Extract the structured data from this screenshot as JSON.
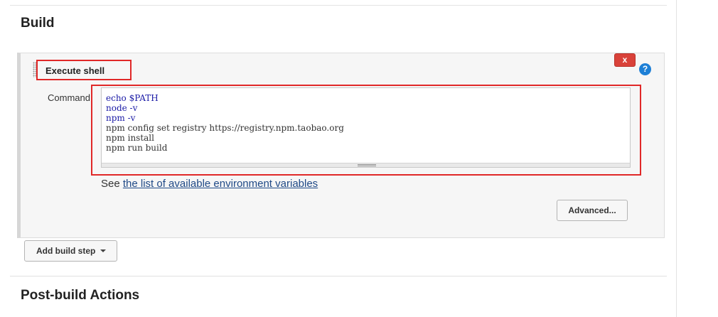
{
  "build": {
    "title": "Build"
  },
  "step": {
    "title": "Execute shell",
    "delete_label": "x",
    "help_label": "?",
    "command_label": "Command",
    "command_lines": [
      "echo $PATH",
      "node -v",
      "npm -v",
      "npm config set registry https://registry.npm.taobao.org",
      "npm install",
      "npm run build"
    ],
    "see_prefix": "See ",
    "env_link_text": "the list of available environment variables",
    "advanced_label": "Advanced..."
  },
  "add_build_step": {
    "label": "Add build step"
  },
  "post_build": {
    "title": "Post-build Actions"
  },
  "icons": {
    "drag": "drag-handle-icon",
    "help": "help-icon",
    "delete": "close-icon",
    "caret": "caret-down-icon"
  },
  "colors": {
    "highlight": "#e02828",
    "delete_button": "#d9423a",
    "help_icon": "#1d7fd6",
    "link": "#204a87"
  }
}
